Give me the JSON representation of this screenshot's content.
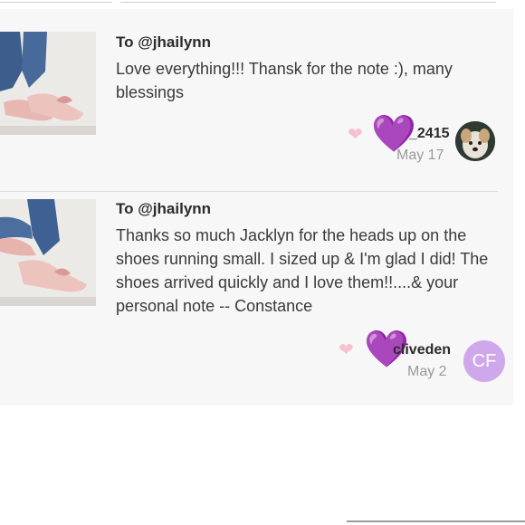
{
  "notes": [
    {
      "to": "To @jhailynn",
      "message": "Love everything!!! Thansk for the note :), many blessings",
      "username": "_2415",
      "date": "May 17",
      "avatar_icon": "dog-avatar-icon"
    },
    {
      "to": "To @jhailynn",
      "message": "Thanks so much Jacklyn for the heads up on the shoes running small. I sized up & I'm glad I did! The shoes arrived quickly and I love them!!....& your personal note -- Constance",
      "username": "cliveden",
      "date": "May 2",
      "avatar_initials": "CF"
    }
  ],
  "colors": {
    "heart_small": "#f6c2cf",
    "heart_big": "#9b2be8",
    "avatar_bg": "#cfa8ec",
    "date": "#9a9a9a"
  },
  "icons": {
    "heart_small": "pink-heart-icon",
    "heart_big": "purple-heart-icon"
  }
}
